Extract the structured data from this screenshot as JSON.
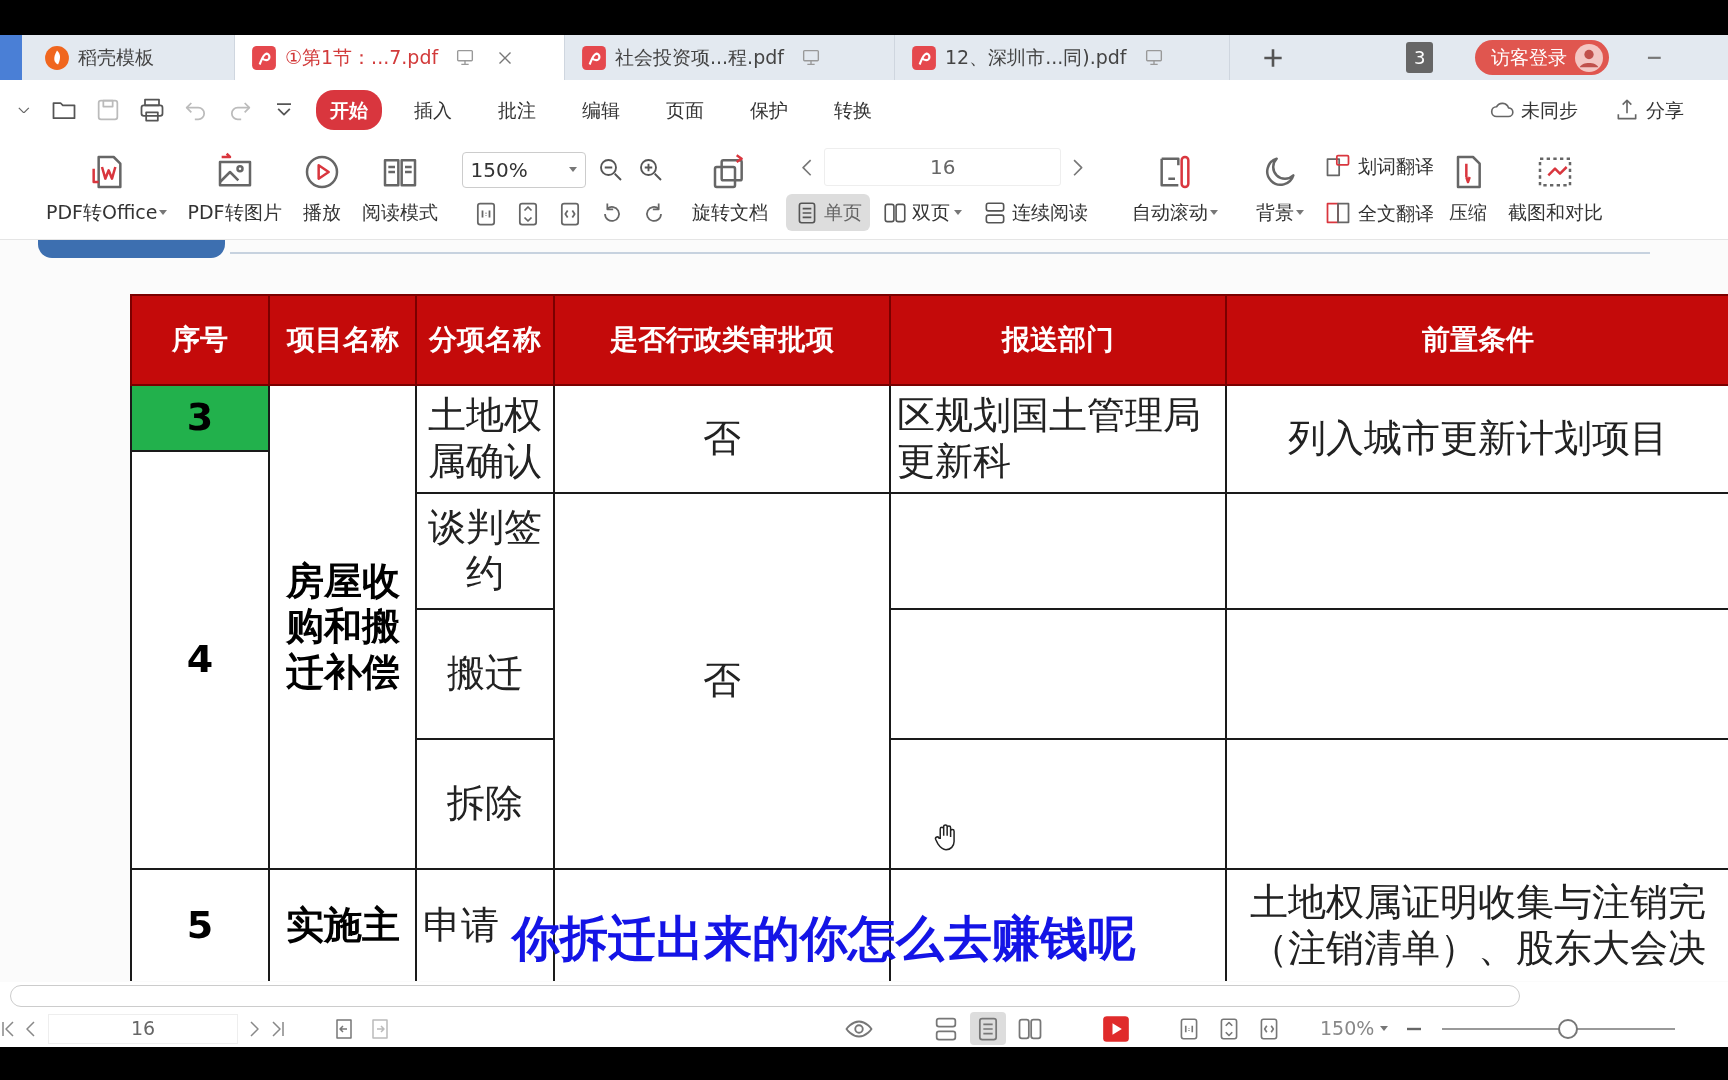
{
  "tabs": [
    {
      "kind": "docer",
      "label": "稻壳模板",
      "selected": false,
      "closable": false
    },
    {
      "kind": "pdf",
      "label": "①第1节：...7.pdf",
      "selected": true,
      "closable": true
    },
    {
      "kind": "pdf",
      "label": "社会投资项...程.pdf",
      "selected": false,
      "closable": false
    },
    {
      "kind": "pdf",
      "label": "12、深圳市...同).pdf",
      "selected": false,
      "closable": false
    }
  ],
  "window_count": "3",
  "login_button": "访客登录",
  "menu_tabs": [
    {
      "label": "开始",
      "selected": true
    },
    {
      "label": "插入",
      "selected": false
    },
    {
      "label": "批注",
      "selected": false
    },
    {
      "label": "编辑",
      "selected": false
    },
    {
      "label": "页面",
      "selected": false
    },
    {
      "label": "保护",
      "selected": false
    },
    {
      "label": "转换",
      "selected": false
    }
  ],
  "header_actions": [
    {
      "kind": "cloud",
      "label": "未同步"
    },
    {
      "kind": "share",
      "label": "分享"
    }
  ],
  "toolbar": {
    "left_tools": [
      {
        "kind": "office",
        "label": "PDF转Office",
        "dropdown": true
      },
      {
        "kind": "image",
        "label": "PDF转图片",
        "dropdown": false
      },
      {
        "kind": "play",
        "label": "播放",
        "dropdown": false
      },
      {
        "kind": "read",
        "label": "阅读模式",
        "dropdown": false
      }
    ],
    "zoom": "150%",
    "rotate_label": "旋转文档",
    "page": "16",
    "view_modes": [
      {
        "kind": "single",
        "label": "单页",
        "selected": true,
        "dropdown": false
      },
      {
        "kind": "double",
        "label": "双页",
        "selected": false,
        "dropdown": true
      },
      {
        "kind": "continuous",
        "label": "连续阅读",
        "selected": false,
        "dropdown": false
      }
    ],
    "right_tools": [
      {
        "kind": "scroll",
        "label": "自动滚动",
        "dropdown": true
      },
      {
        "kind": "moon",
        "label": "背景",
        "dropdown": true
      }
    ],
    "translate": [
      {
        "kind": "word",
        "label": "划词翻译"
      },
      {
        "kind": "full",
        "label": "全文翻译"
      }
    ],
    "end_tools": [
      {
        "kind": "compress",
        "label": "压缩",
        "dropdown": false
      },
      {
        "kind": "compare",
        "label": "截图和对比",
        "dropdown": false
      }
    ]
  },
  "table": {
    "columns": [
      "序号",
      "项目名称",
      "分项名称",
      "是否行政类审批项",
      "报送部门",
      "前置条件"
    ],
    "rows": [
      {
        "cells": [
          {
            "text": "3",
            "highlighted": true
          },
          {
            "text": "房屋收购和搬迁补偿",
            "rowspan": 5
          },
          {
            "text": "土地权属确认",
            "rowspan": 2
          },
          {
            "text": "否",
            "rowspan": 2
          },
          {
            "text": "区规划国土管理局更新科",
            "rowspan": 2
          },
          {
            "text": "列入城市更新计划项目",
            "rowspan": 2
          }
        ]
      },
      {
        "cells": [
          {
            "text": "4",
            "rowspan": 4,
            "highlighted": false
          }
        ]
      },
      {
        "cells": [
          {
            "text": "谈判签约"
          },
          {
            "text": "否",
            "rowspan": 3
          },
          {},
          {}
        ]
      },
      {
        "cells": [
          {
            "text": "搬迁"
          },
          {},
          {}
        ]
      },
      {
        "cells": [
          {
            "text": "拆除"
          },
          {},
          {}
        ]
      },
      {
        "cells": [
          {
            "text": "5",
            "highlighted": false
          },
          {
            "text": "实施主"
          },
          {
            "text": "申请"
          },
          {},
          {},
          {
            "text": "土地权属证明收集与注销完（注销清单）、股东大会决"
          }
        ]
      }
    ]
  },
  "subtitle": "你拆迁出来的你怎么去赚钱呢",
  "status_bar": {
    "page": "16",
    "views": [
      {
        "selected": false
      },
      {
        "selected": true
      },
      {
        "selected": false
      }
    ],
    "zoom": "150%",
    "zoom_slider": {
      "level": 0.54
    }
  }
}
